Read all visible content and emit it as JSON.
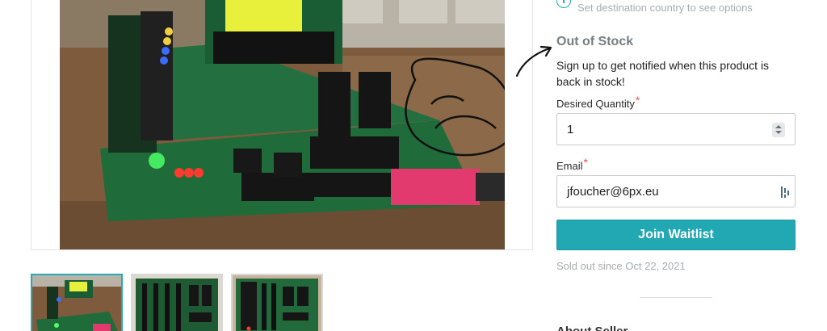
{
  "shipping": {
    "icon": "info-circle-icon",
    "note": "Set destination country to see options"
  },
  "waitlist": {
    "title": "Out of Stock",
    "description": "Sign up to get notified when this product is back in stock!",
    "quantity_label": "Desired Quantity",
    "quantity_value": "1",
    "email_label": "Email",
    "email_value": "jfoucher@6px.eu",
    "required_marker": "*",
    "join_button": "Join Waitlist",
    "sold_out_note": "Sold out since Oct 22, 2021"
  },
  "seller": {
    "heading": "About Seller"
  },
  "gallery": {
    "thumbnail_count": 3,
    "selected_index": 0
  },
  "colors": {
    "accent": "#22a8b3",
    "muted_text": "#a6adb2",
    "required": "#e2574c",
    "board_green": "#1f6b3a"
  }
}
